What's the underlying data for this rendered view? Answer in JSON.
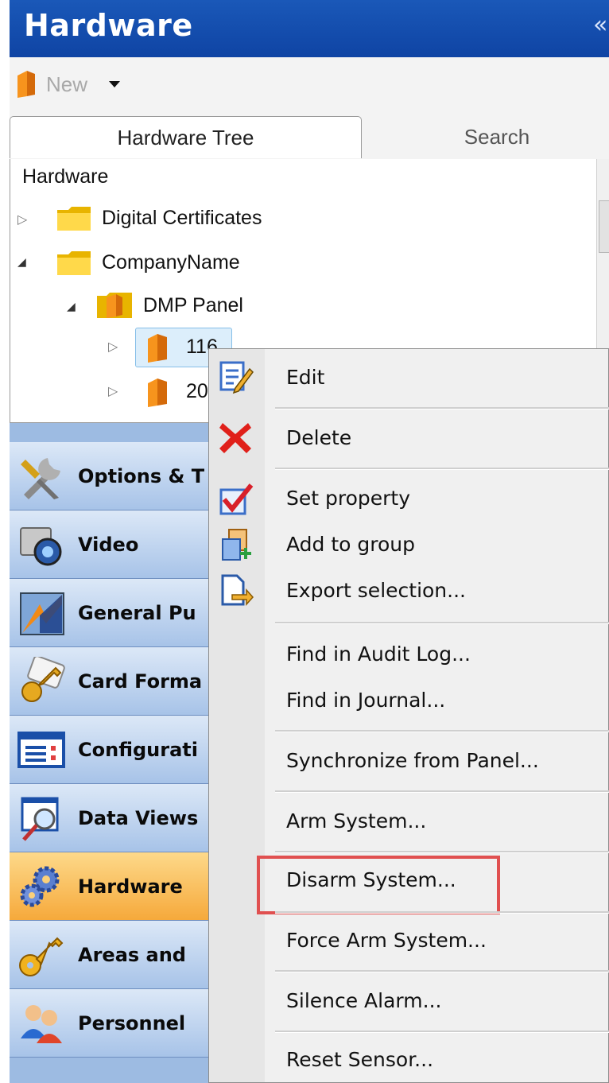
{
  "header": {
    "title": "Hardware",
    "collapse_glyph": "«"
  },
  "toolbar": {
    "new_label": "New",
    "new_icon": "panel-icon",
    "dropdown_icon": "caret-down-icon"
  },
  "tabs": [
    {
      "label": "Hardware Tree",
      "selected": true
    },
    {
      "label": "Search",
      "selected": false
    }
  ],
  "tree": {
    "root": "Hardware",
    "items": [
      {
        "label": "Digital Certificates",
        "icon": "folder-icon",
        "expanded": false
      },
      {
        "label": "CompanyName",
        "icon": "folder-icon",
        "expanded": true
      },
      {
        "label": "DMP Panel",
        "icon": "panel-group-icon",
        "expanded": true
      },
      {
        "label": "116",
        "icon": "panel-icon",
        "expanded": false,
        "selected": true
      },
      {
        "label": "20",
        "icon": "panel-icon",
        "expanded": false
      }
    ]
  },
  "nav": {
    "items": [
      {
        "label": "Options & T",
        "icon": "tools-icon"
      },
      {
        "label": "Video",
        "icon": "camera-icon"
      },
      {
        "label": "General Pu",
        "icon": "general-purpose-icon"
      },
      {
        "label": "Card Forma",
        "icon": "card-key-icon"
      },
      {
        "label": "Configurati",
        "icon": "configuration-icon"
      },
      {
        "label": "Data Views",
        "icon": "data-views-icon"
      },
      {
        "label": "Hardware",
        "icon": "gears-icon",
        "active": true
      },
      {
        "label": "Areas and",
        "icon": "key-icon"
      },
      {
        "label": "Personnel",
        "icon": "people-icon"
      }
    ]
  },
  "context_menu": {
    "items": [
      {
        "label": "Edit",
        "icon": "edit-icon"
      },
      {
        "label": "Delete",
        "icon": "delete-icon"
      },
      {
        "label": "Set property",
        "icon": "checkbox-icon"
      },
      {
        "label": "Add to group",
        "icon": "add-group-icon"
      },
      {
        "label": "Export selection...",
        "icon": "export-icon"
      },
      {
        "label": "Find in Audit Log..."
      },
      {
        "label": "Find in Journal..."
      },
      {
        "label": "Synchronize from Panel..."
      },
      {
        "label": "Arm System..."
      },
      {
        "label": "Disarm System...",
        "highlighted": true
      },
      {
        "label": "Force Arm System..."
      },
      {
        "label": "Silence Alarm..."
      },
      {
        "label": "Reset Sensor..."
      }
    ]
  },
  "colors": {
    "header": "#1550b0",
    "highlight_box": "#e05050",
    "nav_active": "#f6a93b"
  }
}
